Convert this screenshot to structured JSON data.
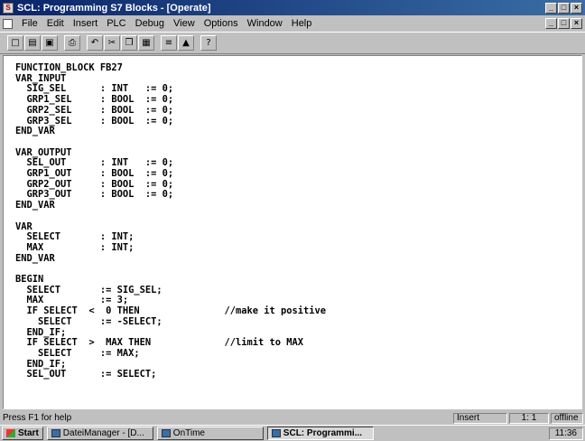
{
  "window": {
    "title": "SCL: Programming S7 Blocks - [Operate]",
    "buttons": [
      "_",
      "□",
      "×"
    ]
  },
  "menubar": {
    "items": [
      "File",
      "Edit",
      "Insert",
      "PLC",
      "Debug",
      "View",
      "Options",
      "Window",
      "Help"
    ],
    "doc_buttons": [
      "_",
      "□",
      "×"
    ]
  },
  "toolbar": {
    "buttons": [
      {
        "name": "new-icon",
        "glyph": "□"
      },
      {
        "name": "open-icon",
        "glyph": "▤"
      },
      {
        "name": "save-icon",
        "glyph": "▣"
      },
      {
        "name": "print-icon",
        "glyph": "⎙"
      },
      {
        "name": "undo-icon",
        "glyph": "↶"
      },
      {
        "name": "cut-icon",
        "glyph": "✂"
      },
      {
        "name": "copy-icon",
        "glyph": "❐"
      },
      {
        "name": "paste-icon",
        "glyph": "▦"
      },
      {
        "name": "compile-icon",
        "glyph": "≡"
      },
      {
        "name": "download-icon",
        "glyph": "▲"
      },
      {
        "name": "help-icon",
        "glyph": "?"
      }
    ]
  },
  "editor": {
    "code": "FUNCTION_BLOCK FB27\nVAR_INPUT\n  SIG_SEL      : INT   := 0;\n  GRP1_SEL     : BOOL  := 0;\n  GRP2_SEL     : BOOL  := 0;\n  GRP3_SEL     : BOOL  := 0;\nEND_VAR\n\nVAR_OUTPUT\n  SEL_OUT      : INT   := 0;\n  GRP1_OUT     : BOOL  := 0;\n  GRP2_OUT     : BOOL  := 0;\n  GRP3_OUT     : BOOL  := 0;\nEND_VAR\n\nVAR\n  SELECT       : INT;\n  MAX          : INT;\nEND_VAR\n\nBEGIN\n  SELECT       := SIG_SEL;\n  MAX          := 3;\n  IF SELECT  <  0 THEN               //make it positive\n    SELECT     := -SELECT;\n  END_IF;\n  IF SELECT  >  MAX THEN             //limit to MAX\n    SELECT     := MAX;\n  END_IF;\n  SEL_OUT      := SELECT;"
  },
  "statusbar": {
    "text": "Press F1 for help",
    "mode": "Insert",
    "position": "1: 1",
    "connection": "offline"
  },
  "taskbar": {
    "start": "Start",
    "tasks": [
      {
        "label": "DateiManager - [D...",
        "active": false
      },
      {
        "label": "OnTime",
        "active": false
      },
      {
        "label": "SCL: Programmi...",
        "active": true
      }
    ],
    "clock": "11:36"
  }
}
